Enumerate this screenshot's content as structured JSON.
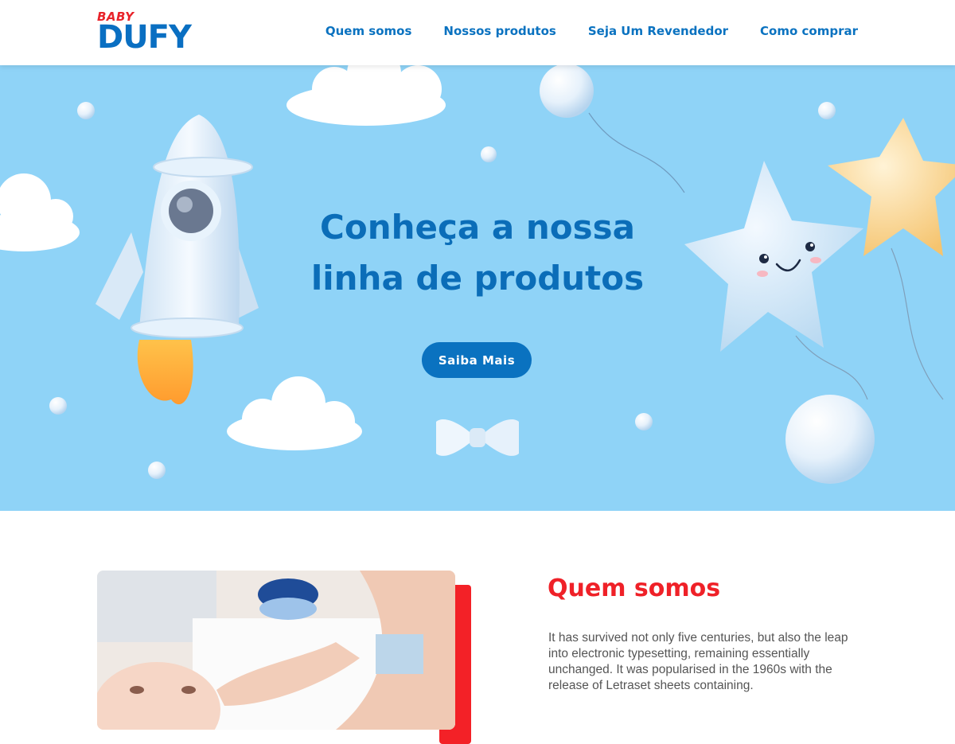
{
  "header": {
    "logo_top": "BABY",
    "logo_main": "DUFY",
    "nav": [
      {
        "label": "Quem somos"
      },
      {
        "label": "Nossos produtos"
      },
      {
        "label": "Seja Um Revendedor"
      },
      {
        "label": "Como comprar"
      }
    ]
  },
  "hero": {
    "title_line1": "Conheça a nossa",
    "title_line2": "linha de produtos",
    "cta_label": "Saiba Mais"
  },
  "about": {
    "title": "Quem somos",
    "text": "It has survived not only five centuries, but also the leap into electronic typesetting, remaining essentially unchanged. It was popularised in the 1960s with the release of Letraset sheets containing."
  },
  "colors": {
    "brand_blue": "#0a72c0",
    "brand_red": "#ef2128",
    "hero_bg": "#8fd3f7"
  }
}
